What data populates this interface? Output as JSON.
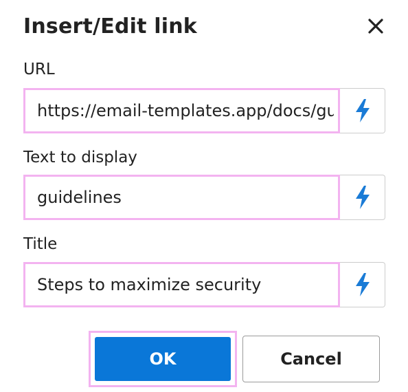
{
  "dialog": {
    "title": "Insert/Edit link",
    "close_icon": "close-icon"
  },
  "fields": {
    "url": {
      "label": "URL",
      "value": "https://email-templates.app/docs/guidelines",
      "button_icon": "lightning-bolt-icon"
    },
    "text": {
      "label": "Text to display",
      "value": "guidelines",
      "button_icon": "lightning-bolt-icon"
    },
    "title": {
      "label": "Title",
      "value": "Steps to maximize security",
      "button_icon": "lightning-bolt-icon"
    }
  },
  "actions": {
    "ok_label": "OK",
    "cancel_label": "Cancel"
  },
  "colors": {
    "accent": "#0a77d8",
    "focus_outline": "#f3b3f0",
    "icon_blue": "#1a7bd6"
  }
}
